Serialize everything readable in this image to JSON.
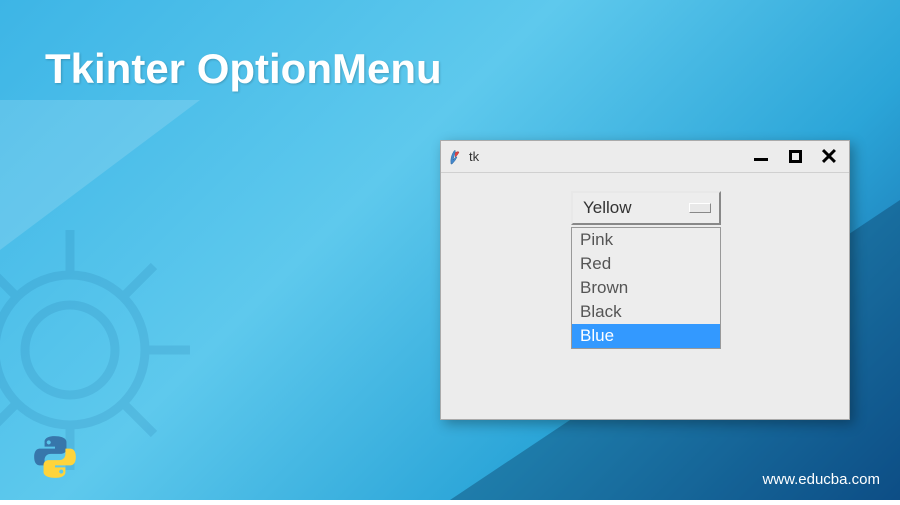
{
  "page": {
    "title": "Tkinter OptionMenu",
    "watermark": "www.educba.com"
  },
  "window": {
    "title": "tk",
    "icon_name": "tk-feather-icon"
  },
  "optionmenu": {
    "selected": "Yellow",
    "options": [
      {
        "label": "Pink",
        "highlighted": false
      },
      {
        "label": "Red",
        "highlighted": false
      },
      {
        "label": "Brown",
        "highlighted": false
      },
      {
        "label": "Black",
        "highlighted": false
      },
      {
        "label": "Blue",
        "highlighted": true
      }
    ]
  },
  "colors": {
    "highlight": "#3399ff",
    "window_bg": "#ececec"
  }
}
